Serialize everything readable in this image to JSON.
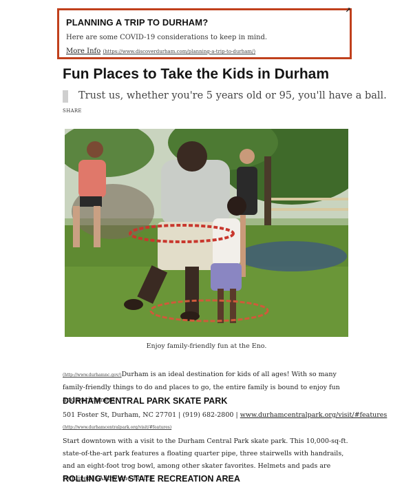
{
  "alert": {
    "title": "PLANNING A TRIP TO DURHAM?",
    "text": "Here are some COVID-19 considerations to keep in mind.",
    "link_label": "More Info",
    "link_url": "(https://www.discoverdurham.com/planning-a-trip-to-durham/)",
    "close_glyph": "↗"
  },
  "article": {
    "title": "Fun Places to Take the Kids in Durham",
    "subtitle": "Trust us, whether you're 5 years old or 95, you'll have a ball.",
    "share_label": "SHARE",
    "photo_caption": "Enjoy family-friendly fun at the Eno.",
    "intro_link": "(http://www.durhamnc.gov/)",
    "intro_text": "Durham is an ideal destination for kids of all ages! With so many family-friendly things to do and places to go, the entire family is bound to enjoy fun and enrichment.",
    "section1": {
      "heading": "DURHAM CENTRAL PARK SKATE PARK",
      "address": "501 Foster St, Durham, NC 27701 | (919) 682-2800 | ",
      "website": "www.durhamcentralpark.org/visit/#features",
      "website_url": "(http://www.durhamcentralpark.org/visit/#features)",
      "body": "Start downtown with a visit to the Durham Central Park skate park. This 10,000-sq-ft. state-of-the-art park features a floating quarter pipe, three stairwells with handrails, and an eight-foot trog bowl, among other skater favorites. Helmets and pads are required! (Allow one hour.)"
    },
    "section2": {
      "heading": "ROLLING VIEW STATE RECREATION AREA"
    }
  },
  "colors": {
    "alert_border": "#c0401c",
    "grass": "#5f8a32"
  }
}
